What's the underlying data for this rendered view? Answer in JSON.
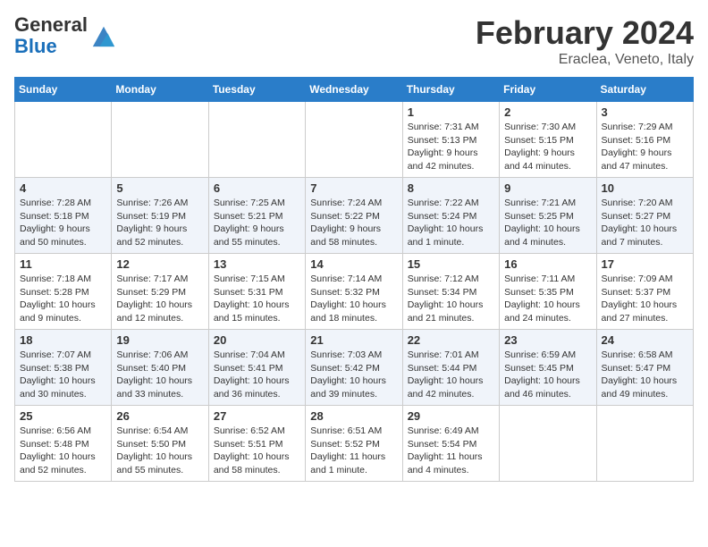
{
  "header": {
    "logo_general": "General",
    "logo_blue": "Blue",
    "month_year": "February 2024",
    "location": "Eraclea, Veneto, Italy"
  },
  "days_of_week": [
    "Sunday",
    "Monday",
    "Tuesday",
    "Wednesday",
    "Thursday",
    "Friday",
    "Saturday"
  ],
  "weeks": [
    [
      {
        "day": "",
        "sunrise": "",
        "sunset": "",
        "daylight": ""
      },
      {
        "day": "",
        "sunrise": "",
        "sunset": "",
        "daylight": ""
      },
      {
        "day": "",
        "sunrise": "",
        "sunset": "",
        "daylight": ""
      },
      {
        "day": "",
        "sunrise": "",
        "sunset": "",
        "daylight": ""
      },
      {
        "day": "1",
        "sunrise": "Sunrise: 7:31 AM",
        "sunset": "Sunset: 5:13 PM",
        "daylight": "Daylight: 9 hours and 42 minutes."
      },
      {
        "day": "2",
        "sunrise": "Sunrise: 7:30 AM",
        "sunset": "Sunset: 5:15 PM",
        "daylight": "Daylight: 9 hours and 44 minutes."
      },
      {
        "day": "3",
        "sunrise": "Sunrise: 7:29 AM",
        "sunset": "Sunset: 5:16 PM",
        "daylight": "Daylight: 9 hours and 47 minutes."
      }
    ],
    [
      {
        "day": "4",
        "sunrise": "Sunrise: 7:28 AM",
        "sunset": "Sunset: 5:18 PM",
        "daylight": "Daylight: 9 hours and 50 minutes."
      },
      {
        "day": "5",
        "sunrise": "Sunrise: 7:26 AM",
        "sunset": "Sunset: 5:19 PM",
        "daylight": "Daylight: 9 hours and 52 minutes."
      },
      {
        "day": "6",
        "sunrise": "Sunrise: 7:25 AM",
        "sunset": "Sunset: 5:21 PM",
        "daylight": "Daylight: 9 hours and 55 minutes."
      },
      {
        "day": "7",
        "sunrise": "Sunrise: 7:24 AM",
        "sunset": "Sunset: 5:22 PM",
        "daylight": "Daylight: 9 hours and 58 minutes."
      },
      {
        "day": "8",
        "sunrise": "Sunrise: 7:22 AM",
        "sunset": "Sunset: 5:24 PM",
        "daylight": "Daylight: 10 hours and 1 minute."
      },
      {
        "day": "9",
        "sunrise": "Sunrise: 7:21 AM",
        "sunset": "Sunset: 5:25 PM",
        "daylight": "Daylight: 10 hours and 4 minutes."
      },
      {
        "day": "10",
        "sunrise": "Sunrise: 7:20 AM",
        "sunset": "Sunset: 5:27 PM",
        "daylight": "Daylight: 10 hours and 7 minutes."
      }
    ],
    [
      {
        "day": "11",
        "sunrise": "Sunrise: 7:18 AM",
        "sunset": "Sunset: 5:28 PM",
        "daylight": "Daylight: 10 hours and 9 minutes."
      },
      {
        "day": "12",
        "sunrise": "Sunrise: 7:17 AM",
        "sunset": "Sunset: 5:29 PM",
        "daylight": "Daylight: 10 hours and 12 minutes."
      },
      {
        "day": "13",
        "sunrise": "Sunrise: 7:15 AM",
        "sunset": "Sunset: 5:31 PM",
        "daylight": "Daylight: 10 hours and 15 minutes."
      },
      {
        "day": "14",
        "sunrise": "Sunrise: 7:14 AM",
        "sunset": "Sunset: 5:32 PM",
        "daylight": "Daylight: 10 hours and 18 minutes."
      },
      {
        "day": "15",
        "sunrise": "Sunrise: 7:12 AM",
        "sunset": "Sunset: 5:34 PM",
        "daylight": "Daylight: 10 hours and 21 minutes."
      },
      {
        "day": "16",
        "sunrise": "Sunrise: 7:11 AM",
        "sunset": "Sunset: 5:35 PM",
        "daylight": "Daylight: 10 hours and 24 minutes."
      },
      {
        "day": "17",
        "sunrise": "Sunrise: 7:09 AM",
        "sunset": "Sunset: 5:37 PM",
        "daylight": "Daylight: 10 hours and 27 minutes."
      }
    ],
    [
      {
        "day": "18",
        "sunrise": "Sunrise: 7:07 AM",
        "sunset": "Sunset: 5:38 PM",
        "daylight": "Daylight: 10 hours and 30 minutes."
      },
      {
        "day": "19",
        "sunrise": "Sunrise: 7:06 AM",
        "sunset": "Sunset: 5:40 PM",
        "daylight": "Daylight: 10 hours and 33 minutes."
      },
      {
        "day": "20",
        "sunrise": "Sunrise: 7:04 AM",
        "sunset": "Sunset: 5:41 PM",
        "daylight": "Daylight: 10 hours and 36 minutes."
      },
      {
        "day": "21",
        "sunrise": "Sunrise: 7:03 AM",
        "sunset": "Sunset: 5:42 PM",
        "daylight": "Daylight: 10 hours and 39 minutes."
      },
      {
        "day": "22",
        "sunrise": "Sunrise: 7:01 AM",
        "sunset": "Sunset: 5:44 PM",
        "daylight": "Daylight: 10 hours and 42 minutes."
      },
      {
        "day": "23",
        "sunrise": "Sunrise: 6:59 AM",
        "sunset": "Sunset: 5:45 PM",
        "daylight": "Daylight: 10 hours and 46 minutes."
      },
      {
        "day": "24",
        "sunrise": "Sunrise: 6:58 AM",
        "sunset": "Sunset: 5:47 PM",
        "daylight": "Daylight: 10 hours and 49 minutes."
      }
    ],
    [
      {
        "day": "25",
        "sunrise": "Sunrise: 6:56 AM",
        "sunset": "Sunset: 5:48 PM",
        "daylight": "Daylight: 10 hours and 52 minutes."
      },
      {
        "day": "26",
        "sunrise": "Sunrise: 6:54 AM",
        "sunset": "Sunset: 5:50 PM",
        "daylight": "Daylight: 10 hours and 55 minutes."
      },
      {
        "day": "27",
        "sunrise": "Sunrise: 6:52 AM",
        "sunset": "Sunset: 5:51 PM",
        "daylight": "Daylight: 10 hours and 58 minutes."
      },
      {
        "day": "28",
        "sunrise": "Sunrise: 6:51 AM",
        "sunset": "Sunset: 5:52 PM",
        "daylight": "Daylight: 11 hours and 1 minute."
      },
      {
        "day": "29",
        "sunrise": "Sunrise: 6:49 AM",
        "sunset": "Sunset: 5:54 PM",
        "daylight": "Daylight: 11 hours and 4 minutes."
      },
      {
        "day": "",
        "sunrise": "",
        "sunset": "",
        "daylight": ""
      },
      {
        "day": "",
        "sunrise": "",
        "sunset": "",
        "daylight": ""
      }
    ]
  ]
}
